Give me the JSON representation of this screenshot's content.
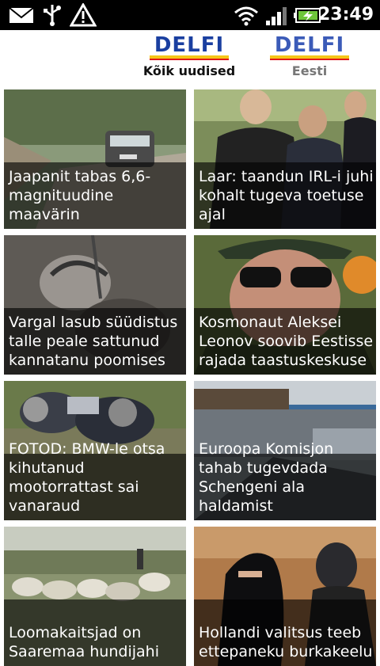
{
  "status_bar": {
    "time": "23:49",
    "icons": [
      "mail-icon",
      "usb-icon",
      "warning-icon",
      "wifi-icon",
      "signal-icon",
      "battery-charging-icon"
    ]
  },
  "tabs": [
    {
      "logo": "DELFI",
      "label": "Kõik uudised",
      "active": true
    },
    {
      "logo": "DELFI",
      "label": "Eesti",
      "active": false
    }
  ],
  "articles": [
    {
      "title": "Jaapanit tabas 6,6-magnituudine maavärin"
    },
    {
      "title": "Laar: taandun IRL-i juhi kohalt tugeva toetuse ajal"
    },
    {
      "title": "Vargal lasub süüdistus talle peale sattunud kannatanu poomises"
    },
    {
      "title": "Kosmonaut Aleksei Leonov soovib Eestisse rajada taastuskeskuse"
    },
    {
      "title": "FOTOD: BMW-le otsa kihutanud mootorrattast sai vanaraud"
    },
    {
      "title": "Euroopa Komisjon tahab tugevdada Schengeni ala haldamist"
    },
    {
      "title": "Loomakaitsjad on Saaremaa hundijahi"
    },
    {
      "title": "Hollandi valitsus teeb ettepaneku burkakeelu"
    }
  ],
  "colors": {
    "brand_blue": "#1a3fa0",
    "brand_yellow": "#f5c518",
    "brand_red": "#e01818",
    "caption_overlay": "rgba(0,0,0,0.62)"
  }
}
